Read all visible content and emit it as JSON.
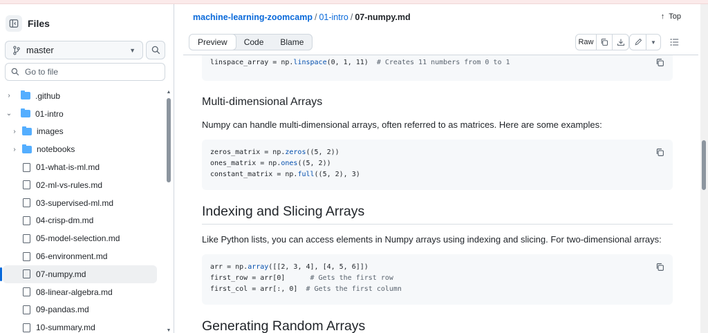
{
  "sidebar": {
    "title": "Files",
    "branch": "master",
    "goto_placeholder": "Go to file",
    "tree": [
      {
        "label": ".github",
        "type": "folder",
        "expanded": false
      },
      {
        "label": "01-intro",
        "type": "folder",
        "expanded": true
      },
      {
        "label": "images",
        "type": "folder",
        "expanded": false
      },
      {
        "label": "notebooks",
        "type": "folder",
        "expanded": false
      },
      {
        "label": "01-what-is-ml.md",
        "type": "file"
      },
      {
        "label": "02-ml-vs-rules.md",
        "type": "file"
      },
      {
        "label": "03-supervised-ml.md",
        "type": "file"
      },
      {
        "label": "04-crisp-dm.md",
        "type": "file"
      },
      {
        "label": "05-model-selection.md",
        "type": "file"
      },
      {
        "label": "06-environment.md",
        "type": "file"
      },
      {
        "label": "07-numpy.md",
        "type": "file",
        "selected": true
      },
      {
        "label": "08-linear-algebra.md",
        "type": "file"
      },
      {
        "label": "09-pandas.md",
        "type": "file"
      },
      {
        "label": "10-summary.md",
        "type": "file"
      }
    ]
  },
  "breadcrumb": {
    "repo": "machine-learning-zoomcamp",
    "sep1": "/",
    "folder": "01-intro",
    "sep2": "/",
    "file": "07-numpy.md"
  },
  "top_link": "Top",
  "tabs": [
    "Preview",
    "Code",
    "Blame"
  ],
  "toolbar": {
    "raw": "Raw"
  },
  "content": {
    "code0": {
      "pre": "linspace_array = np.",
      "fn": "linspace",
      "args": "(0, 1, 11)  ",
      "comment": "# Creates 11 numbers from 0 to 1"
    },
    "h_multi": "Multi-dimensional Arrays",
    "p_multi": "Numpy can handle multi-dimensional arrays, often referred to as matrices. Here are some examples:",
    "code1": [
      {
        "pre": "zeros_matrix = np.",
        "fn": "zeros",
        "post": "((5, 2))"
      },
      {
        "pre": "ones_matrix = np.",
        "fn": "ones",
        "post": "((5, 2))"
      },
      {
        "pre": "constant_matrix = np.",
        "fn": "full",
        "post": "((5, 2), 3)"
      }
    ],
    "h_index": "Indexing and Slicing Arrays",
    "p_index": "Like Python lists, you can access elements in Numpy arrays using indexing and slicing. For two-dimensional arrays:",
    "code2": [
      {
        "pre": "arr = np.",
        "fn": "array",
        "post": "([[2, 3, 4], [4, 5, 6]])",
        "comment": ""
      },
      {
        "pre": "first_row = arr[0]      ",
        "fn": "",
        "post": "",
        "comment": "# Gets the first row"
      },
      {
        "pre": "first_col = arr[:, 0]  ",
        "fn": "",
        "post": "",
        "comment": "# Gets the first column"
      }
    ],
    "h_random": "Generating Random Arrays"
  }
}
